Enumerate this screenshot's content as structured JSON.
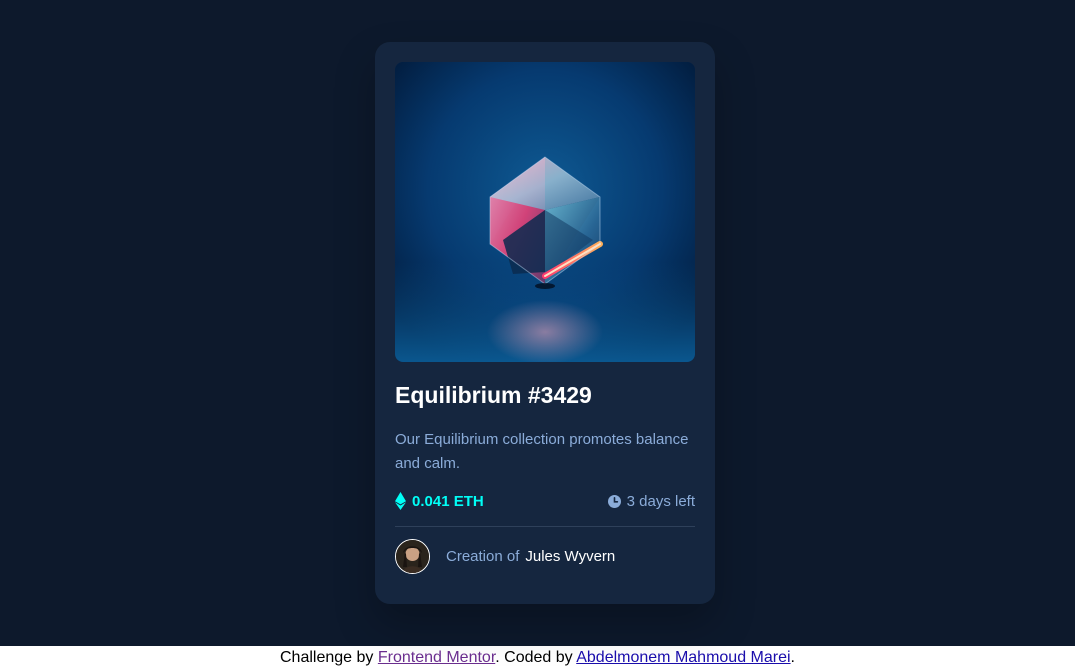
{
  "card": {
    "title": "Equilibrium #3429",
    "description": "Our Equilibrium collection promotes balance and calm.",
    "price": "0.041 ETH",
    "time_left": "3 days left",
    "creator_prefix": "Creation of",
    "creator_name": "Jules Wyvern"
  },
  "attribution": {
    "challenge_prefix": "Challenge by",
    "challenge_link": "Frontend Mentor",
    "coded_prefix": ". Coded by",
    "author_link": "Abdelmonem Mahmoud Marei",
    "suffix": "."
  },
  "icons": {
    "price": "ethereum-icon",
    "time": "clock-icon",
    "hero": "equilibrium-cube-image",
    "avatar": "creator-avatar"
  },
  "colors": {
    "page_bg": "#0d192c",
    "card_bg": "#15263f",
    "accent_cyan": "#00fff7",
    "soft_blue": "#8bacd9",
    "white": "#ffffff"
  }
}
